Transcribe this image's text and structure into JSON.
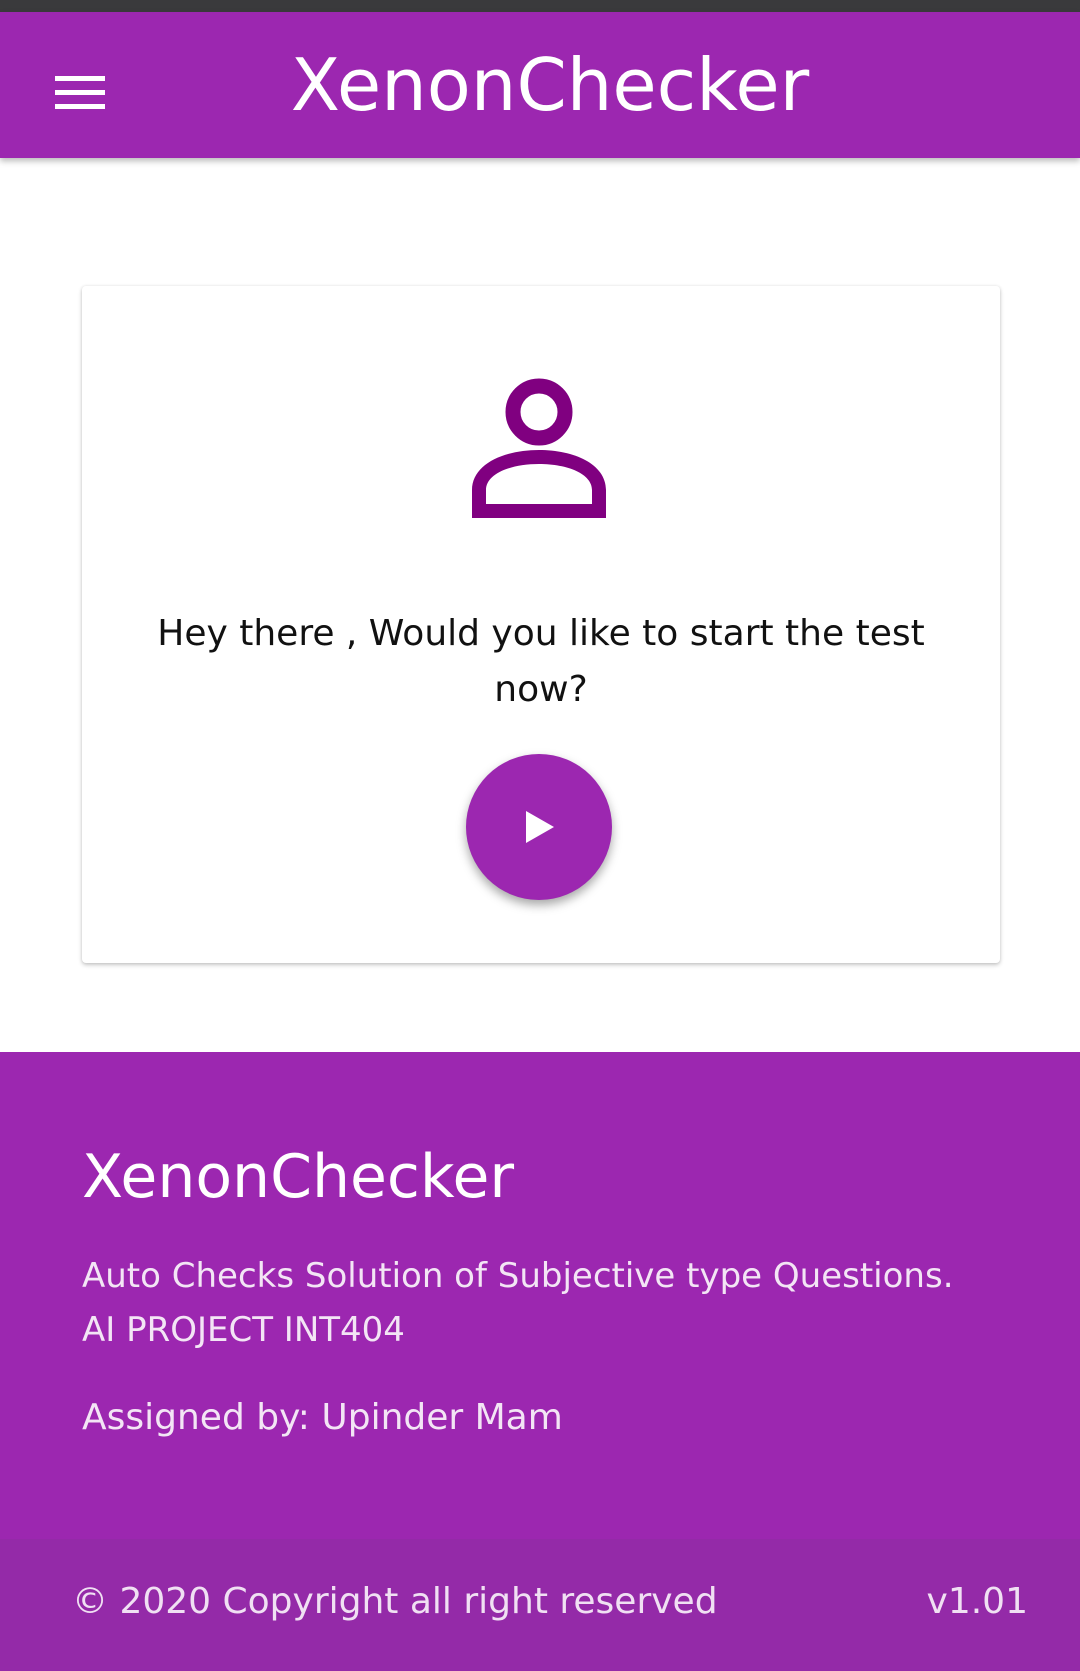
{
  "app_bar": {
    "title": "XenonChecker",
    "menu_icon": "hamburger-menu-icon",
    "color": "#9c27b0"
  },
  "card": {
    "icon": "person-outline-icon",
    "icon_color": "#800080",
    "message": "Hey there , Would you like to start the test now?",
    "start_button_icon": "play-icon"
  },
  "footer": {
    "title": "XenonChecker",
    "description_line1": "Auto Checks Solution of Subjective type Questions.",
    "description_line2": "AI PROJECT INT404",
    "assigned_by": "Assigned by: Upinder Mam",
    "copyright": "© 2020 Copyright all right reserved",
    "version": "v1.01"
  }
}
